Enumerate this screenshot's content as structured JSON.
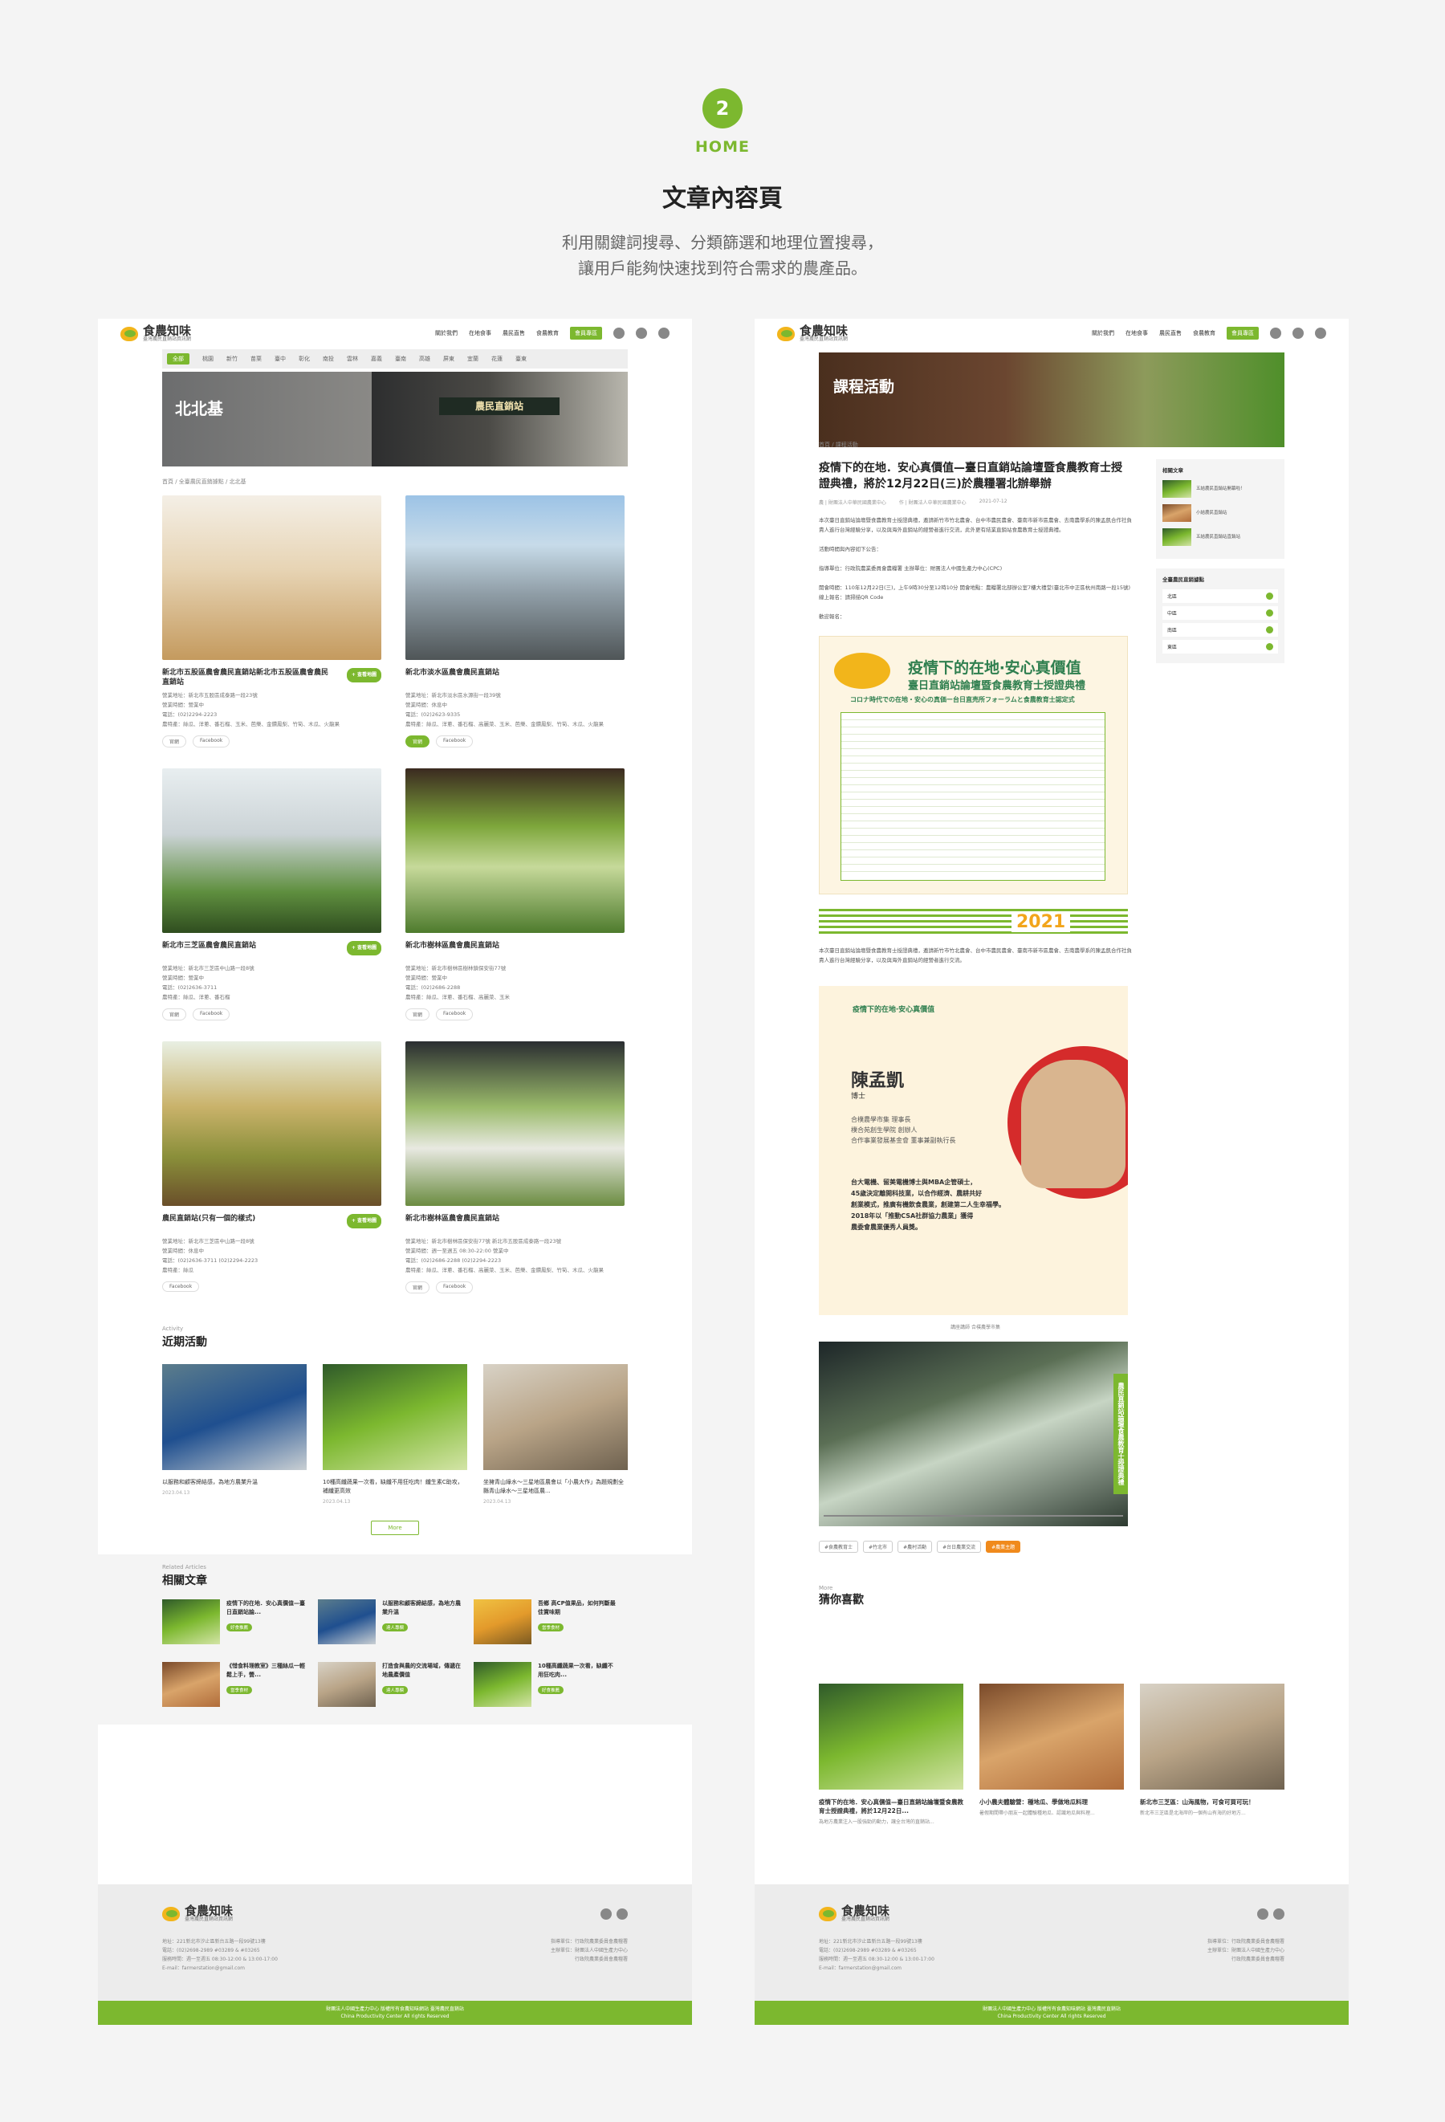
{
  "header": {
    "step": "2",
    "section": "HOME",
    "title": "文章內容頁",
    "subtitle_l1": "利用關鍵詞搜尋、分類篩選和地理位置搜尋，",
    "subtitle_l2": "讓用戶能夠快速找到符合需求的農產品。"
  },
  "brand": {
    "name": "食農知味",
    "tagline": "臺灣農民直銷站資訊網",
    "accent": "#7cb82f",
    "orange": "#f08a1c"
  },
  "nav": {
    "about": "關於我們",
    "local": "在地食事",
    "direct": "農民直售",
    "edu": "食農教育",
    "member": "會員專區"
  },
  "left": {
    "cats": [
      "全部",
      "桃園",
      "新竹",
      "苗栗",
      "臺中",
      "彰化",
      "南投",
      "雲林",
      "嘉義",
      "臺南",
      "高雄",
      "屏東",
      "宜蘭",
      "花蓮",
      "臺東"
    ],
    "banner_title": "北北基",
    "banner_sign": "農民直銷站",
    "crumb": "首頁 / 全臺農民直銷據點 / 北北基",
    "stores": [
      {
        "name": "新北市五股區農會農民直銷站新北市五股區農會農民直銷站",
        "tag": "+ 查看地圖",
        "l1": "營業地址：新北市五股區成泰路一段23號",
        "l2": "營業時間：營業中",
        "l3": "電話：(02)2294-2223",
        "l4": "農特產：絲瓜、洋蔥、番石榴、玉米、芭樂、金鑽鳳梨、竹筍、木瓜、火龍果",
        "b1": "官網",
        "b2": "Facebook"
      },
      {
        "name": "新北市淡水區農會農民直銷站",
        "tag": "",
        "l1": "營業地址：新北市淡水區水源街一段39號",
        "l2": "營業時間：休息中",
        "l3": "電話：(02)2623-9335",
        "l4": "農特產：絲瓜、洋蔥、番石榴、高麗菜、玉米、芭樂、金鑽鳳梨、竹筍、木瓜、火龍果",
        "b1": "官網",
        "b2": "Facebook"
      },
      {
        "name": "新北市三芝區農會農民直銷站",
        "tag": "+ 查看地圖",
        "l1": "營業地址：新北市三芝區中山路一段8號",
        "l2": "營業時間：營業中",
        "l3": "電話：(02)2636-3711",
        "l4": "農特產：絲瓜、洋蔥、番石榴",
        "b1": "官網",
        "b2": "Facebook"
      },
      {
        "name": "新北市樹林區農會農民直銷站",
        "tag": "",
        "l1": "營業地址：新北市樹林區樹林鎮保安街77號",
        "l2": "營業時間：營業中",
        "l3": "電話：(02)2686-2288",
        "l4": "農特產：絲瓜、洋蔥、番石榴、高麗菜、玉米",
        "b1": "官網",
        "b2": "Facebook"
      },
      {
        "name": "農民直銷站(只有一個的樣式)",
        "tag": "+ 查看地圖",
        "l1": "營業地址：新北市三芝區中山路一段8號",
        "l2": "營業時間：休息中",
        "l3": "電話：(02)2636-3711 (02)2294-2223",
        "l4": "農特產：絲瓜",
        "b1": "",
        "b2": "Facebook"
      },
      {
        "name": "新北市樹林區農會農民直銷站",
        "tag": "",
        "l1": "營業地址：新北市樹林區保安街77號 新北市五股區成泰路一段23號",
        "l2": "營業時間：週一至週五 08:30-22:00 營業中",
        "l3": "電話：(02)2686-2288 (02)2294-2223",
        "l4": "農特產：絲瓜、洋蔥、番石榴、高麗菜、玉米、芭樂、金鑽鳳梨、竹筍、木瓜、火龍果",
        "b1": "官網",
        "b2": "Facebook"
      }
    ],
    "act_en": "Activity",
    "act_zh": "近期活動",
    "acts": [
      {
        "t": "以服務和顧客締結感，為地方農業升溫",
        "d": "2023.04.13"
      },
      {
        "t": "10種高纖蔬果一次看，缺纖不用狂吃肉！纖生素C助攻，補纖更高效",
        "d": "2023.04.13"
      },
      {
        "t": "坐擁青山綠水～三星地區農會以「小農大作」為題規劃全縣青山綠水～三星地區農...",
        "d": "2023.04.13"
      }
    ],
    "more": "More",
    "rel_en": "Related Articles",
    "rel_zh": "相關文章",
    "rels": [
      {
        "t": "疫情下的在地．安心真價值—臺日直銷站論...",
        "tg": "好食推薦"
      },
      {
        "t": "以服務和顧客締結感，為地方農業升溫",
        "tg": "達人專欄"
      },
      {
        "t": "吾鄉 高CP值果品，如何判斷最佳賞味期",
        "tg": "當季食材"
      },
      {
        "t": "《惜食料理教室》三種絲瓜一輕鬆上手，營...",
        "tg": "當季食材"
      },
      {
        "t": "打造食與農的交流場域，傳遞在地農產價值",
        "tg": "達人專欄"
      },
      {
        "t": "10種高纖蔬果一次看，缺纖不用狂吃肉...",
        "tg": "好食推薦"
      }
    ]
  },
  "right": {
    "banner_title": "課程活動",
    "crumb": "首頁 / 課程活動",
    "title": "疫情下的在地．安心真價值—臺日直銷站論壇暨食農教育士授證典禮，將於12月22日(三)於農糧署北辦舉辦",
    "meta1": "農 | 財團法人中華民國農業中心",
    "meta2": "作 | 財團法人中華民國農業中心",
    "date": "2021-07-12",
    "p1": "本次臺日直銷站論壇暨食農教育士授證典禮，邀請新竹市竹北農會、台中市農民農會、臺南市新市區農會、去南農學系的陳孟凱合作社負責人進行台灣經驗分享，以及與海外直銷站的經營者進行交流，此外更有結業直銷站食農教育士授證典禮。",
    "p2": "活動時間與內容如下公告：",
    "p3": "指導單位：行政院農業委員會農糧署 主辦單位：財團法人中國生產力中心(CPC)",
    "p4": "開會時間：110年12月22日(三)，上午9時30分至12時10分 開會地點：農糧署北部辦公室7樓大禮堂(臺北市中正區杭州南路一段15號) 線上報名：請掃描QR Code",
    "p5": "歡迎報名：",
    "poster_t1": "疫情下的在地‧安心真價值",
    "poster_t2": "臺日直銷站論壇暨食農教育士授證典禮",
    "poster_t3": "コロナ時代での在地・安心の真価ー台日直売所フォーラムと食農教育士認定式",
    "year": "2021",
    "p6": "本次臺日直銷站論壇暨食農教育士授證典禮，邀請新竹市竹北農會、台中市農民農會、臺南市新市區農會、去南農學系的陳孟凱合作社負責人進行台灣經驗分享，以及與海外直銷站的經營者進行交流。",
    "sp_hd": "疫情下的在地‧安心真價值",
    "sp_name": "陳孟凱",
    "sp_title": "博士",
    "sp_d1": "合樸農學市集 理事長",
    "sp_d2": "樸合苑創生學院 創辦人",
    "sp_d3": "合作事業發展基金會 董事兼副執行長",
    "sp_b1": "台大電機、留美電機博士與MBA企管碩士，",
    "sp_b2": "45歲決定離開科技業，以合作經濟、農耕共好",
    "sp_b3": "創業模式，推廣有機飲食農業，創建第二人生幸福學。",
    "sp_b4": "2018年以「推動CSA社群協力農業」獲得",
    "sp_b5": "農委會農業優秀人員獎。",
    "cap": "講座講師 合樸農學市集",
    "video_t": "農民直銷站論壇食農教育士授證典禮",
    "tags": [
      "#食農教育士",
      "#竹北市",
      "#農村活動",
      "#台日農業交流",
      "#農業主題"
    ],
    "like_en": "More",
    "like_zh": "猜你喜歡",
    "likes": [
      {
        "t": "疫情下的在地．安心真價值—臺日直銷站論壇暨食農教育士授證典禮，將於12月22日...",
        "d": "為地方農業注入一股強勁的動力，讓全台灣的直銷站..."
      },
      {
        "t": "小小農夫體驗營：種地瓜、學做地瓜料理",
        "d": "暑假期間帶小朋友一起體驗種地瓜、認識地瓜與料理..."
      },
      {
        "t": "新北市三芝區：山海風物，可食可買可玩！",
        "d": "新北市三芝區是北海岸的一個有山有海的好地方..."
      }
    ],
    "side_h1": "相關文章",
    "side_items": [
      "五結農民直銷站開幕啦！",
      "小結農民直銷站",
      "五結農民直銷站直銷站"
    ],
    "side_h2": "全臺農民直銷據點",
    "side_cats": [
      "北區",
      "中區",
      "南區",
      "東區"
    ]
  },
  "footer": {
    "brand": "食農知味",
    "tag": "臺灣農民直銷站資訊網",
    "a1": "地址：221新北市汐止區新台五路一段99號13樓",
    "a2": "電話：(02)2698-2989 #03289 & #03265",
    "a3": "服務時間：週一至週五 08:30-12:00 & 13:00-17:00",
    "a4": "E-mail：farmerstation@gmail.com",
    "r1": "指導單位：行政院農業委員會農糧署",
    "r2": "主辦單位：財團法人中國生產力中心",
    "r3": "行政院農業委員會農糧署",
    "cp1": "財團法人中國生產力中心 版權所有食農知味網站 臺灣農民直銷站",
    "cp2": "China Productivity Center All rights Reserved"
  }
}
